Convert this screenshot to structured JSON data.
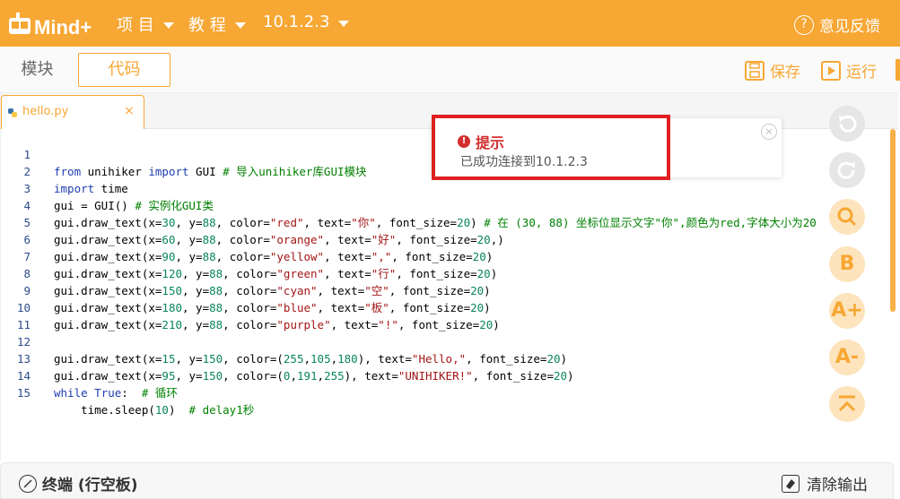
{
  "brand": {
    "logo_text": "Mind+"
  },
  "topbar": {
    "menu_project": "项 目",
    "menu_tutorial": "教 程",
    "menu_device": "10.1.2.3",
    "feedback": "意见反馈"
  },
  "toolbar": {
    "tab_blocks": "模块",
    "tab_code": "代码",
    "save": "保存",
    "run": "运行"
  },
  "editor": {
    "file_tab": "hello.py",
    "file_close": "×",
    "lines": [
      {
        "n": "1"
      },
      {
        "n": "2"
      },
      {
        "n": "3"
      },
      {
        "n": "4"
      },
      {
        "n": "5"
      },
      {
        "n": "6"
      },
      {
        "n": "7"
      },
      {
        "n": "8"
      },
      {
        "n": "9"
      },
      {
        "n": "10"
      },
      {
        "n": "11"
      },
      {
        "n": "12"
      },
      {
        "n": "13"
      },
      {
        "n": "14"
      },
      {
        "n": "15"
      }
    ]
  },
  "code": {
    "l1": "from unihiker import GUI # 导入unihiker库GUI模块",
    "l2": "import time",
    "l3": "gui = GUI() # 实例化GUI类",
    "l4": "gui.draw_text(x=30, y=88, color=\"red\", text=\"你\", font_size=20) # 在 (30, 88) 坐标位显示文字\"你\",颜色为red,字体大小为20",
    "l5": "gui.draw_text(x=60, y=88, color=\"orange\", text=\"好\", font_size=20,)",
    "l6": "gui.draw_text(x=90, y=88, color=\"yellow\", text=\",\", font_size=20)",
    "l7": "gui.draw_text(x=120, y=88, color=\"green\", text=\"行\", font_size=20)",
    "l8": "gui.draw_text(x=150, y=88, color=\"cyan\", text=\"空\", font_size=20)",
    "l9": "gui.draw_text(x=180, y=88, color=\"blue\", text=\"板\", font_size=20)",
    "l10": "gui.draw_text(x=210, y=88, color=\"purple\", text=\"!\", font_size=20)",
    "l11": "",
    "l12": "gui.draw_text(x=15, y=150, color=(255,105,180), text=\"Hello,\", font_size=20)",
    "l13": "gui.draw_text(x=95, y=150, color=(0,191,255), text=\"UNIHIKER!\", font_size=20)",
    "l14": "while True:  # 循环",
    "l15": "    time.sleep(10)  # delay1秒"
  },
  "toast": {
    "title": "提示",
    "message": "已成功连接到10.1.2.3",
    "close": "×"
  },
  "side_tools": {
    "undo": "undo-icon",
    "redo": "redo-icon",
    "search": "search-icon",
    "format": "B",
    "font_up": "A+",
    "font_down": "A-",
    "to_top": "to-top-icon"
  },
  "terminal": {
    "title": "终端 (行空板)",
    "clear": "清除输出"
  },
  "colors": {
    "accent": "#f7a733",
    "error": "#d32f2f",
    "highlight_border": "#e02020"
  }
}
